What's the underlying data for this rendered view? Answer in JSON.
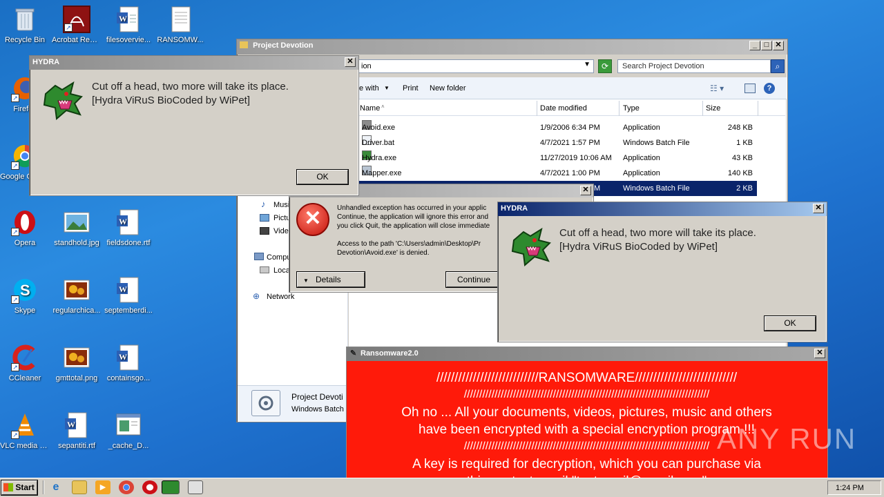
{
  "desktop": {
    "icons": [
      {
        "label": "Recycle Bin"
      },
      {
        "label": "Acrobat Reader DC"
      },
      {
        "label": "filesovervie..."
      },
      {
        "label": "RANSOMW..."
      },
      {
        "label": "Firefox"
      },
      {
        "label": "Google Chrome"
      },
      {
        "label": "Opera"
      },
      {
        "label": "standhold.jpg"
      },
      {
        "label": "fieldsdone.rtf"
      },
      {
        "label": "Skype"
      },
      {
        "label": "regularchica..."
      },
      {
        "label": "septemberdi..."
      },
      {
        "label": "CCleaner"
      },
      {
        "label": "gmttotal.png"
      },
      {
        "label": "containsgo..."
      },
      {
        "label": "VLC media player"
      },
      {
        "label": "sepantiti.rtf"
      },
      {
        "label": "_cache_D..."
      }
    ]
  },
  "explorer": {
    "title": "Project Devotion",
    "address_fragment": "ion",
    "search_placeholder": "Search Project Devotion",
    "toolbar": {
      "open_with": "e with",
      "print": "Print",
      "new_folder": "New folder"
    },
    "columns": [
      "Name",
      "Date modified",
      "Type",
      "Size"
    ],
    "files": [
      {
        "name": "Avoid.exe",
        "date": "1/9/2006 6:34 PM",
        "type": "Application",
        "size": "248 KB"
      },
      {
        "name": "Driver.bat",
        "date": "4/7/2021 1:57 PM",
        "type": "Windows Batch File",
        "size": "1 KB"
      },
      {
        "name": "Hydra.exe",
        "date": "11/27/2019 10:06 AM",
        "type": "Application",
        "size": "43 KB"
      },
      {
        "name": "Mapper.exe",
        "date": "4/7/2021 1:00 PM",
        "type": "Application",
        "size": "140 KB"
      },
      {
        "name": "",
        "date": "M",
        "type": "Windows Batch File",
        "size": "2 KB"
      }
    ],
    "nav": {
      "music": "Musi",
      "pictures": "Pictu",
      "videos": "Vide",
      "computer": "Compu",
      "local": "Loca",
      "network": "Network"
    },
    "details": {
      "name": "Project Devoti",
      "type": "Windows Batch F"
    }
  },
  "hydra1": {
    "title": "HYDRA",
    "line1": "Cut off a head, two more will take its place.",
    "line2": "[Hydra ViRuS BioCoded by WiPet]",
    "ok": "OK"
  },
  "hydra2": {
    "title": "HYDRA",
    "line1": "Cut off a head, two more will take its place.",
    "line2": "[Hydra ViRuS BioCoded by WiPet]",
    "ok": "OK"
  },
  "error": {
    "line1": "Unhandled exception has occurred in your applic",
    "line2": "Continue, the application will ignore this error and",
    "line3": "you click Quit, the application will close immediate",
    "line4": "Access to the path 'C:\\Users\\admin\\Desktop\\Pr",
    "line5": "Devotion\\Avoid.exe' is denied.",
    "details": "Details",
    "continue": "Continue"
  },
  "ransomware": {
    "title": "Ransomware2.0",
    "l1": "////////////////////////////RANSOMWARE////////////////////////////",
    "l2": "////////////////////////////////////////////////////////////////////////////////",
    "l3": "Oh no ... All your documents, videos, pictures, music and others",
    "l4": "have been encrypted with a special encryption program !!!",
    "l5": "////////////////////////////////////////////////////////////////////////////////",
    "l6": "A key is required for decryption, which you can purchase via",
    "l7": "this contact email \"testemail@gmail.com\"",
    "l8": "////////////////////////////////////////////////////////////////////////////////"
  },
  "watermark": "ANY RUN",
  "taskbar": {
    "start": "Start",
    "clock": "1:24 PM"
  },
  "colors": {
    "ransom_red": "#ff1a0a",
    "desktop_blue": "#1f72cf",
    "titlebar_active": "#0a246a"
  }
}
